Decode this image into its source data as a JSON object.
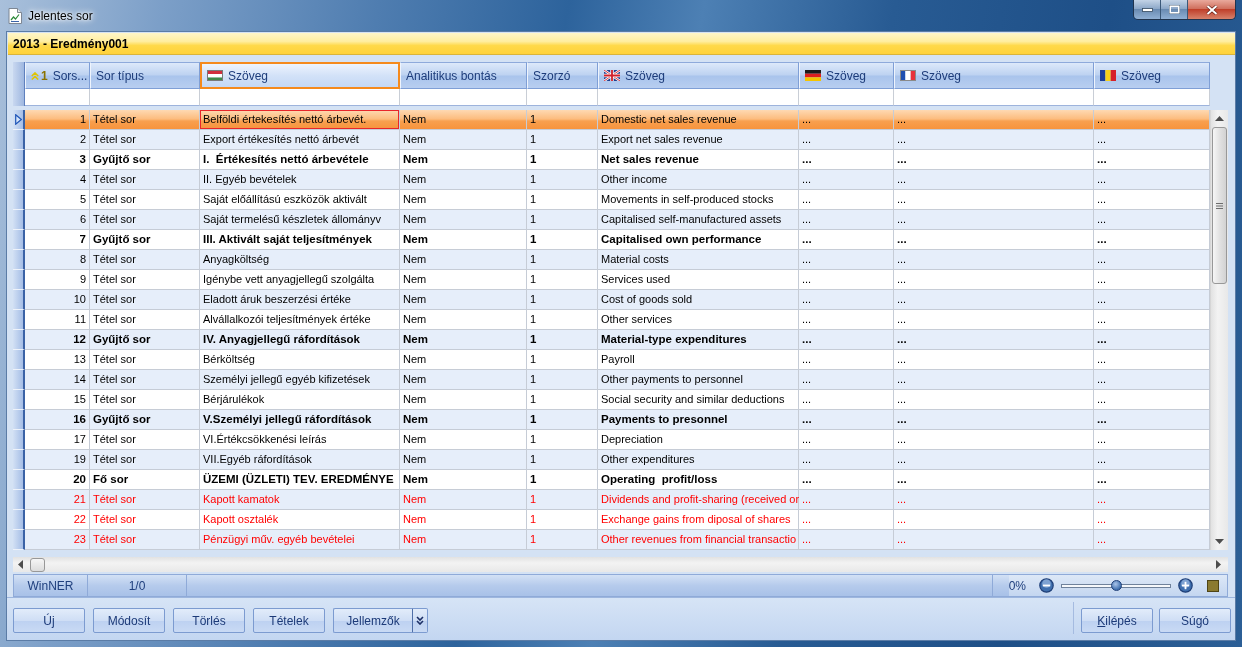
{
  "window": {
    "title": "Jelentes sor"
  },
  "report_header": {
    "title": "2013 - Eredmény001"
  },
  "table": {
    "columns": [
      {
        "label": "Sors...",
        "kind": "number",
        "sort_order": "1",
        "selected": false
      },
      {
        "label": "Sor típus",
        "kind": "text",
        "selected": false
      },
      {
        "label": "Szöveg",
        "kind": "hu",
        "selected": true
      },
      {
        "label": "Analitikus bontás",
        "kind": "text",
        "selected": false
      },
      {
        "label": "Szorzó",
        "kind": "text",
        "selected": false
      },
      {
        "label": "Szöveg",
        "kind": "gb",
        "selected": false
      },
      {
        "label": "Szöveg",
        "kind": "de",
        "selected": false
      },
      {
        "label": "Szöveg",
        "kind": "fr",
        "selected": false
      },
      {
        "label": "Szöveg",
        "kind": "ro",
        "selected": false
      }
    ],
    "rows": [
      {
        "kind": "item",
        "selected": true,
        "highlighted": false,
        "cells": [
          "1",
          "Tétel sor",
          "Belföldi értekesítés nettó árbevét.",
          "Nem",
          "1",
          "Domestic net sales revenue",
          "...",
          "...",
          "..."
        ]
      },
      {
        "kind": "item",
        "selected": false,
        "highlighted": false,
        "cells": [
          "2",
          "Tétel sor",
          "Export értékesítés nettó árbevét",
          "Nem",
          "1",
          "Export net sales revenue",
          "...",
          "...",
          "..."
        ]
      },
      {
        "kind": "group",
        "selected": false,
        "highlighted": false,
        "cells": [
          "3",
          "Gyűjtő sor",
          "I.  Értékesítés nettó árbevétele",
          "Nem",
          "1",
          "Net sales revenue",
          "...",
          "...",
          "..."
        ]
      },
      {
        "kind": "item",
        "selected": false,
        "highlighted": false,
        "cells": [
          "4",
          "Tétel sor",
          "II. Egyéb bevételek",
          "Nem",
          "1",
          "Other income",
          "...",
          "...",
          "..."
        ]
      },
      {
        "kind": "item",
        "selected": false,
        "highlighted": false,
        "cells": [
          "5",
          "Tétel sor",
          "Saját előállítású eszközök aktivált",
          "Nem",
          "1",
          "Movements in self-produced stocks",
          "...",
          "...",
          "..."
        ]
      },
      {
        "kind": "item",
        "selected": false,
        "highlighted": false,
        "cells": [
          "6",
          "Tétel sor",
          "Saját termelésű készletek állományv",
          "Nem",
          "1",
          "Capitalised self-manufactured assets",
          "...",
          "...",
          "..."
        ]
      },
      {
        "kind": "group",
        "selected": false,
        "highlighted": false,
        "cells": [
          "7",
          "Gyűjtő sor",
          "III. Aktivált saját teljesítmények",
          "Nem",
          "1",
          "Capitalised own performance",
          "...",
          "...",
          "..."
        ]
      },
      {
        "kind": "item",
        "selected": false,
        "highlighted": false,
        "cells": [
          "8",
          "Tétel sor",
          "Anyagköltség",
          "Nem",
          "1",
          "Material costs",
          "...",
          "...",
          "..."
        ]
      },
      {
        "kind": "item",
        "selected": false,
        "highlighted": false,
        "cells": [
          "9",
          "Tétel sor",
          "Igénybe vett anyagjellegű szolgálta",
          "Nem",
          "1",
          "Services used",
          "...",
          "...",
          "..."
        ]
      },
      {
        "kind": "item",
        "selected": false,
        "highlighted": false,
        "cells": [
          "10",
          "Tétel sor",
          "Eladott áruk beszerzési értéke",
          "Nem",
          "1",
          "Cost of goods sold",
          "...",
          "...",
          "..."
        ]
      },
      {
        "kind": "item",
        "selected": false,
        "highlighted": false,
        "cells": [
          "11",
          "Tétel sor",
          "Alvállalkozói teljesítmények értéke",
          "Nem",
          "1",
          "Other services",
          "...",
          "...",
          "..."
        ]
      },
      {
        "kind": "group",
        "selected": false,
        "highlighted": false,
        "cells": [
          "12",
          "Gyűjtő sor",
          "IV. Anyagjellegű ráfordítások",
          "Nem",
          "1",
          "Material-type expenditures",
          "...",
          "...",
          "..."
        ]
      },
      {
        "kind": "item",
        "selected": false,
        "highlighted": false,
        "cells": [
          "13",
          "Tétel sor",
          "Bérköltség",
          "Nem",
          "1",
          "Payroll",
          "...",
          "...",
          "..."
        ]
      },
      {
        "kind": "item",
        "selected": false,
        "highlighted": false,
        "cells": [
          "14",
          "Tétel sor",
          "Személyi jellegű egyéb kifizetések",
          "Nem",
          "1",
          "Other payments to personnel",
          "...",
          "...",
          "..."
        ]
      },
      {
        "kind": "item",
        "selected": false,
        "highlighted": false,
        "cells": [
          "15",
          "Tétel sor",
          "Bérjárulékok",
          "Nem",
          "1",
          "Social security and similar deductions",
          "...",
          "...",
          "..."
        ]
      },
      {
        "kind": "group",
        "selected": false,
        "highlighted": false,
        "cells": [
          "16",
          "Gyűjtő sor",
          "V.Személyi jellegű ráfordítások",
          "Nem",
          "1",
          "Payments to presonnel",
          "...",
          "...",
          "..."
        ]
      },
      {
        "kind": "item",
        "selected": false,
        "highlighted": false,
        "cells": [
          "17",
          "Tétel sor",
          "VI.Értékcsökkenési leírás",
          "Nem",
          "1",
          "Depreciation",
          "...",
          "...",
          "..."
        ]
      },
      {
        "kind": "item",
        "selected": false,
        "highlighted": false,
        "cells": [
          "19",
          "Tétel sor",
          "VII.Egyéb ráfordítások",
          "Nem",
          "1",
          "Other expenditures",
          "...",
          "...",
          "..."
        ]
      },
      {
        "kind": "main",
        "selected": false,
        "highlighted": false,
        "cells": [
          "20",
          "Fő sor",
          "ÜZEMI (ÜZLETI) TEV. EREDMÉNYE",
          "Nem",
          "1",
          "Operating  profit/loss",
          "...",
          "...",
          "..."
        ]
      },
      {
        "kind": "item",
        "selected": false,
        "highlighted": true,
        "cells": [
          "21",
          "Tétel sor",
          "Kapott kamatok",
          "Nem",
          "1",
          "Dividends and profit-sharing (received or",
          "...",
          "...",
          "..."
        ]
      },
      {
        "kind": "item",
        "selected": false,
        "highlighted": true,
        "cells": [
          "22",
          "Tétel sor",
          "Kapott osztalék",
          "Nem",
          "1",
          "Exchange gains from diposal of shares",
          "...",
          "...",
          "..."
        ]
      },
      {
        "kind": "item",
        "selected": false,
        "highlighted": true,
        "cells": [
          "23",
          "Tétel sor",
          "Pénzügyi műv. egyéb bevételei",
          "Nem",
          "1",
          "Other revenues from financial transactio",
          "...",
          "...",
          "..."
        ]
      }
    ]
  },
  "status_bar": {
    "fields": [
      "WinNER",
      "1/0"
    ],
    "zoom": {
      "reading": "0%",
      "level": 0.5
    }
  },
  "button_bar": {
    "left": [
      {
        "label": "Új",
        "kind": "plain",
        "access_key_shown": false
      },
      {
        "label": "Módosít",
        "kind": "plain",
        "access_key_shown": false
      },
      {
        "label": "Törlés",
        "kind": "plain",
        "access_key_shown": false
      },
      {
        "label": "Tételek",
        "kind": "plain",
        "access_key_shown": false
      },
      {
        "label": "Jellemzők",
        "kind": "split",
        "access_key_shown": false
      }
    ],
    "right": [
      {
        "label": "Kilépés",
        "kind": "plain",
        "access_key_shown": true
      },
      {
        "label": "Súgó",
        "kind": "plain",
        "access_key_shown": false
      }
    ]
  }
}
